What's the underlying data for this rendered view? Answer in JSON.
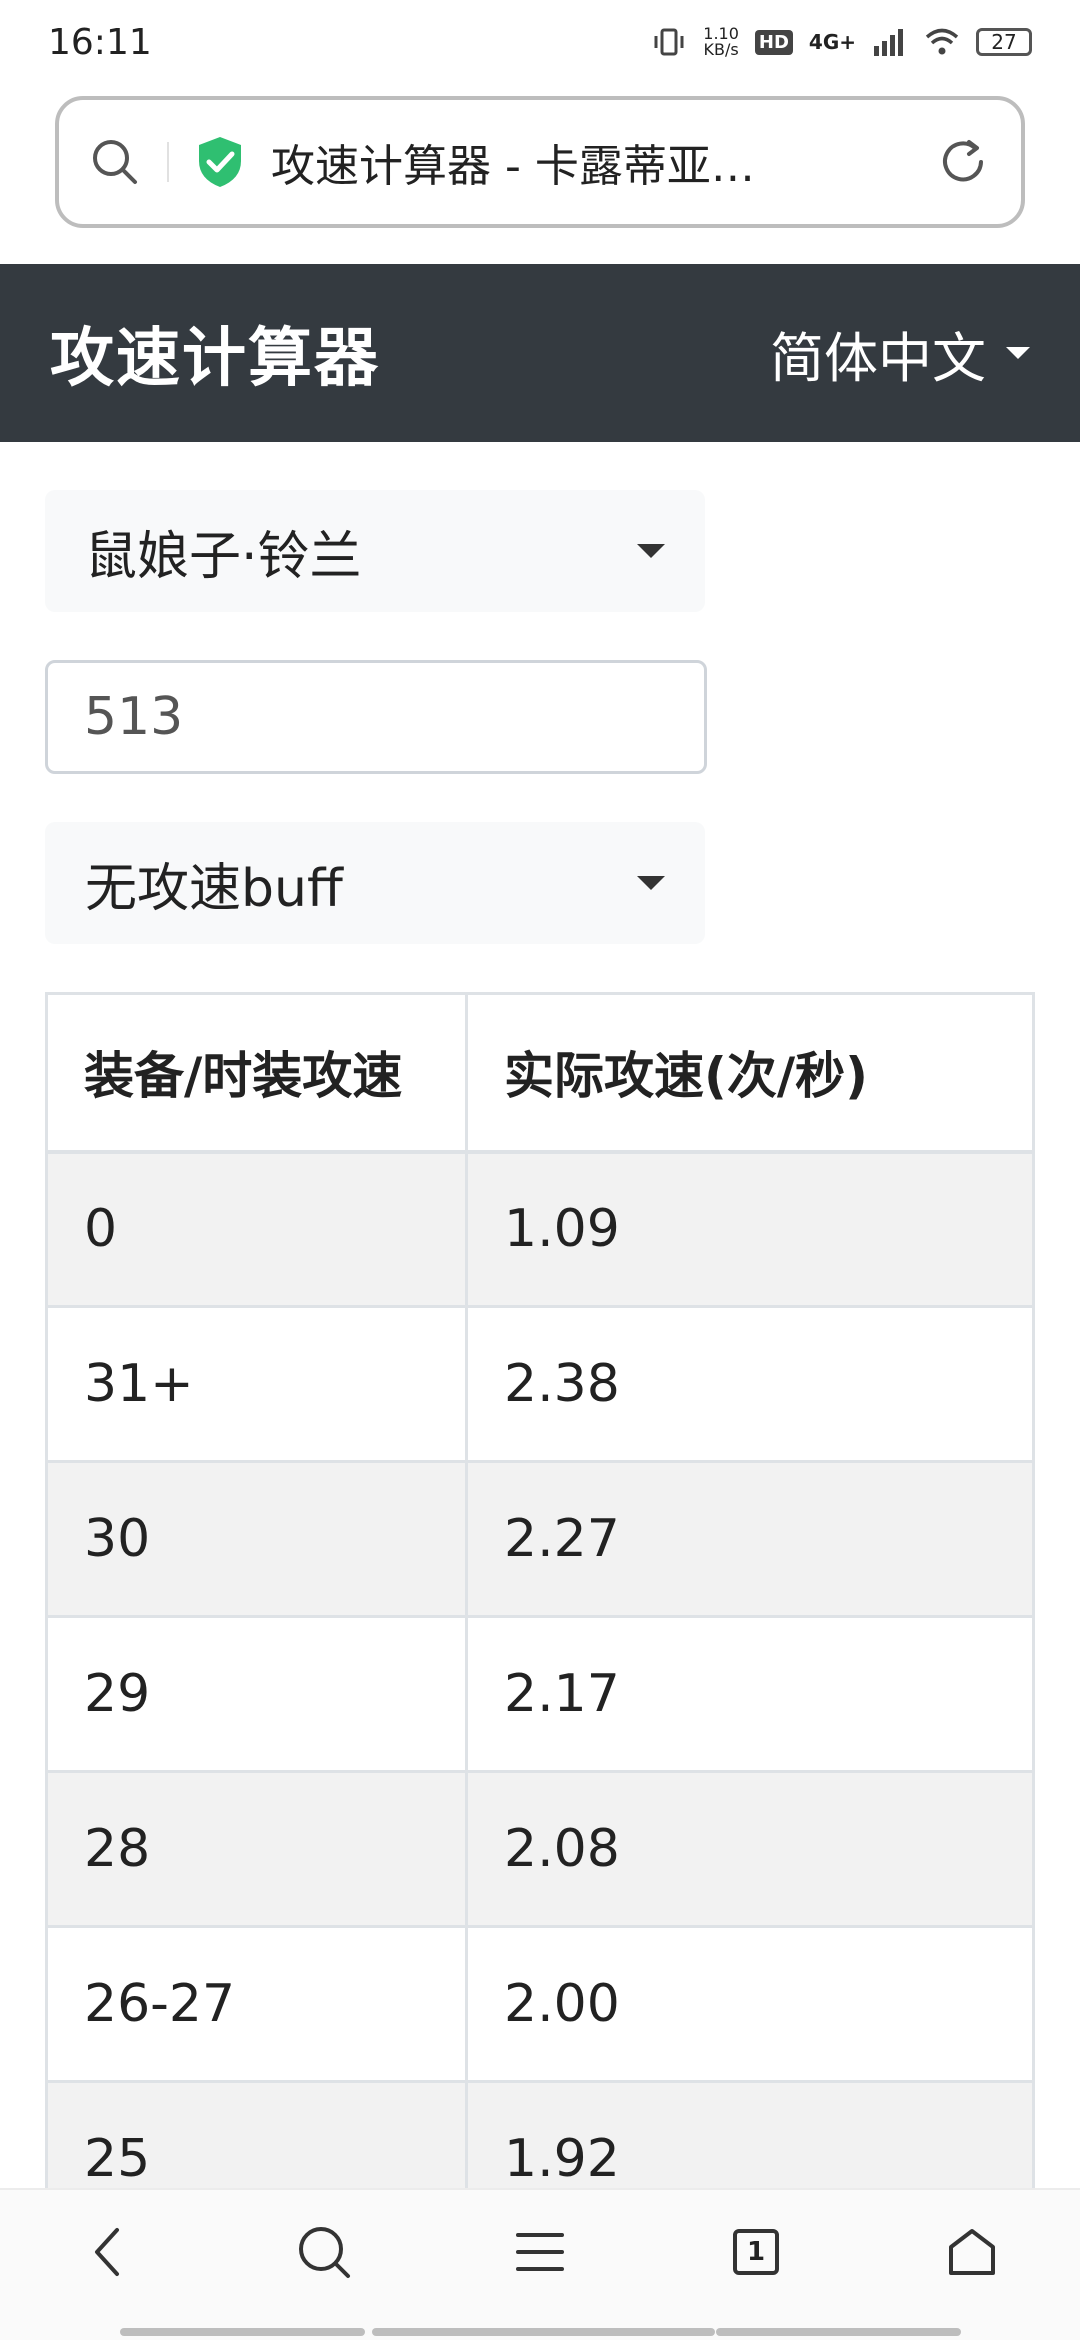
{
  "status": {
    "time": "16:11",
    "net_speed_top": "1.10",
    "net_speed_bottom": "KB/s",
    "hd": "HD",
    "network": "4G+",
    "battery": "27"
  },
  "address": {
    "title": "攻速计算器 - 卡露蒂亚…"
  },
  "header": {
    "title": "攻速计算器",
    "language": "简体中文"
  },
  "form": {
    "character": "鼠娘子·铃兰",
    "value": "513",
    "buff": "无攻速buff"
  },
  "table": {
    "headers": [
      "装备/时装攻速",
      "实际攻速(次/秒)"
    ],
    "rows": [
      [
        "0",
        "1.09"
      ],
      [
        "31+",
        "2.38"
      ],
      [
        "30",
        "2.27"
      ],
      [
        "29",
        "2.17"
      ],
      [
        "28",
        "2.08"
      ],
      [
        "26-27",
        "2.00"
      ],
      [
        "25",
        "1.92"
      ]
    ]
  },
  "bottom_nav": {
    "tabs_count": "1"
  }
}
